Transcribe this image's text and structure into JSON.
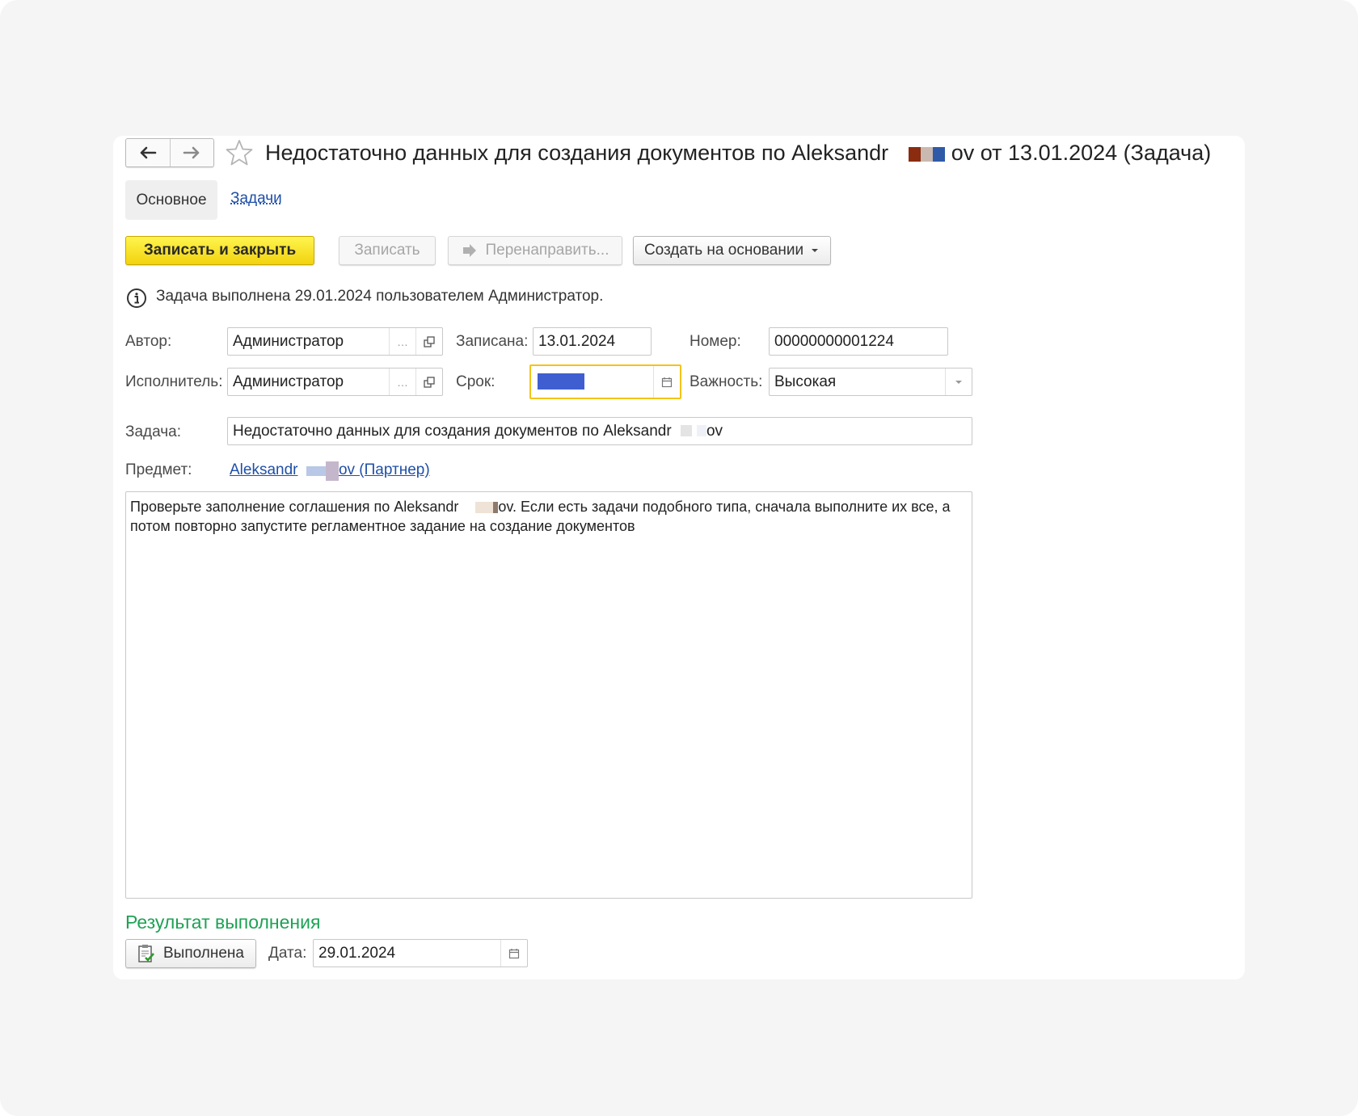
{
  "window": {
    "title_start": "Недостаточно данных для создания документов по Aleksandr",
    "title_end": "ov от 13.01.2024 (Задача)"
  },
  "tabs": {
    "main": "Основное",
    "tasks": "Задачи"
  },
  "toolbar": {
    "save_close": "Записать и закрыть",
    "save": "Записать",
    "redirect": "Перенаправить...",
    "create_based": "Создать на основании"
  },
  "info": {
    "message": "Задача выполнена 29.01.2024 пользователем Администратор."
  },
  "form": {
    "author_label": "Автор:",
    "author_value": "Администратор",
    "recorded_label": "Записана:",
    "recorded_value": "13.01.2024",
    "number_label": "Номер:",
    "number_value": "00000000001224",
    "executor_label": "Исполнитель:",
    "executor_value": "Администратор",
    "deadline_label": "Срок:",
    "deadline_value": ". .",
    "importance_label": "Важность:",
    "importance_value": "Высокая",
    "task_label": "Задача:",
    "task_value_start": "Недостаточно данных для создания документов по Aleksandr",
    "task_value_end": "ov",
    "subject_label": "Предмет:",
    "subject_link_start": "Aleksandr",
    "subject_link_end": "ov (Партнер)",
    "description_start": "Проверьте заполнение соглашения по Aleksandr",
    "description_end": "ov. Если есть задачи подобного типа, сначала выполните их все, а потом повторно запустите регламентное задание на создание документов"
  },
  "result": {
    "section_title": "Результат выполнения",
    "done_button": "Выполнена",
    "date_label": "Дата:",
    "date_value": "29.01.2024"
  },
  "icons": {
    "back": "arrow-left-icon",
    "forward": "arrow-right-icon",
    "favorite": "star-icon",
    "info": "info-icon",
    "select": "ellipsis-icon",
    "open": "open-window-icon",
    "calendar": "calendar-icon",
    "dropdown": "chevron-down-icon",
    "done": "clipboard-check-icon",
    "redirect": "redirect-arrow-icon"
  },
  "colors": {
    "primary_button": "#f5d516",
    "link": "#1f4fa8",
    "section_title": "#1ea255",
    "focus_border": "#f4c417",
    "selection": "#3f5fd1"
  }
}
